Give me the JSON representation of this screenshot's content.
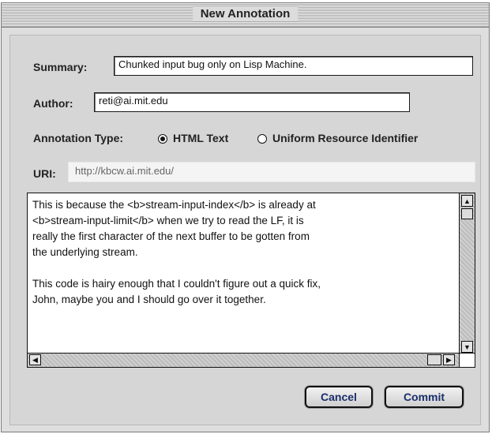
{
  "window": {
    "title": "New Annotation"
  },
  "form": {
    "summary_label": "Summary:",
    "summary_value": "Chunked input bug only on Lisp Machine.",
    "author_label": "Author:",
    "author_value": "reti@ai.mit.edu",
    "annotation_type_label": "Annotation Type:",
    "annotation_types": [
      {
        "label": "HTML Text",
        "selected": true
      },
      {
        "label": "Uniform Resource Identifier",
        "selected": false
      }
    ],
    "uri_label": "URI:",
    "uri_value": "http://kbcw.ai.mit.edu/",
    "body_text": "This is because the <b>stream-input-index</b> is already at\n<b>stream-input-limit</b> when we try to read the LF, it is\nreally the first character of the next buffer to be gotten from\nthe underlying stream.\n\nThis code is hairy enough that I couldn't figure out a quick fix,\nJohn, maybe you and I should go over it together."
  },
  "buttons": {
    "cancel": "Cancel",
    "commit": "Commit"
  },
  "icons": {
    "scroll_up": "scroll-up-arrow-icon",
    "scroll_down": "scroll-down-arrow-icon",
    "scroll_left": "scroll-left-arrow-icon",
    "scroll_right": "scroll-right-arrow-icon"
  }
}
